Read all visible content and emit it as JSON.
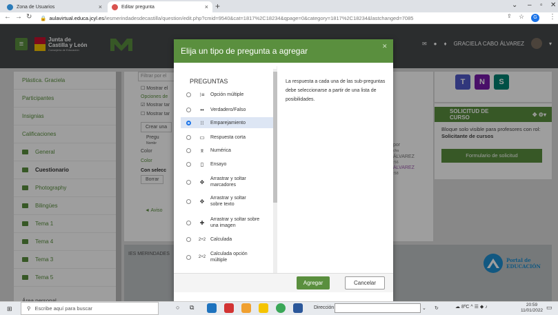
{
  "browser": {
    "tabs": [
      {
        "title": "Zona de Usuarios",
        "icon": "moodle-icon"
      },
      {
        "title": "Editar pregunta",
        "icon": "moodle-icon"
      }
    ],
    "url_domain": "aulavirtual.educa.jcyl.es",
    "url_path": "/iesmerindadesdecastilla/question/edit.php?cmid=9540&cat=1817%2C18234&qpage=0&category=1817%2C18234&lastchanged=7085"
  },
  "header": {
    "org_name_line1": "Junta de",
    "org_name_line2": "Castilla y León",
    "org_subtitle": "Consejería de Educación",
    "user_name": "GRACIELA CABO ÁLVAREZ"
  },
  "sidebar": {
    "items": [
      {
        "label": "Plástica. Graciela",
        "icon": ""
      },
      {
        "label": "Participantes",
        "icon": ""
      },
      {
        "label": "Insignias",
        "icon": ""
      },
      {
        "label": "Calificaciones",
        "icon": ""
      },
      {
        "label": "General",
        "icon": "folder-icon"
      },
      {
        "label": "Cuestionario",
        "icon": "folder-icon"
      },
      {
        "label": "Photography",
        "icon": "folder-icon"
      },
      {
        "label": "Bilingües",
        "icon": "folder-icon"
      },
      {
        "label": "Tema 1",
        "icon": "folder-icon"
      },
      {
        "label": "Tema 4",
        "icon": "folder-icon"
      },
      {
        "label": "Tema 3",
        "icon": "folder-icon"
      },
      {
        "label": "Tema 5",
        "icon": "folder-icon"
      },
      {
        "label": "Área personal",
        "icon": ""
      }
    ]
  },
  "background": {
    "filter_placeholder": "Filtrar por el",
    "show_a": "Mostrar el",
    "options": "Opciones de",
    "show_b": "Mostrar tar",
    "show_c": "Mostrar tar",
    "create": "Crear una",
    "col_preg": "Pregu",
    "col_nombre": "Nombr",
    "row_color1": "Color",
    "row_color2": "Color",
    "with_selected": "Con selecc",
    "delete": "Borrar",
    "notice": "◄ Aviso",
    "footer_school": "IES MERINDADES",
    "mid_por": "por",
    "mid_fecha": "cha",
    "mid_alvarez1": "ÁLVAREZ",
    "mid_56a": ":56",
    "mid_alvarez2": "ÁLVAREZ",
    "mid_56b": ":58"
  },
  "right_block": {
    "title_line1": "SOLICITUD DE",
    "title_line2": "CURSO",
    "text_part1": "Bloque solo visible para profesores con rol: ",
    "text_bold": "Solicitante de cursos",
    "button_label": "Formulario de solicitud",
    "portal_label1": "Portal de",
    "portal_label2": "EDUCACIÓN",
    "ms_teams": "T",
    "ms_onenote": "N",
    "ms_sway": "S"
  },
  "modal": {
    "title": "Elija un tipo de pregunta a agregar",
    "list_heading": "PREGUNTAS",
    "questions": [
      {
        "label": "Opción múltiple",
        "icon": "list-icon",
        "glyph": "⁝≡",
        "selected": false
      },
      {
        "label": "Verdadero/Falso",
        "icon": "dots-icon",
        "glyph": "••",
        "selected": false
      },
      {
        "label": "Emparejamiento",
        "icon": "matching-icon",
        "glyph": "⁝⁝",
        "selected": true
      },
      {
        "label": "Respuesta corta",
        "icon": "short-answer-icon",
        "glyph": "▭",
        "selected": false
      },
      {
        "label": "Numérica",
        "icon": "numeric-icon",
        "glyph": "⌆",
        "selected": false
      },
      {
        "label": "Ensayo",
        "icon": "essay-icon",
        "glyph": "▯",
        "selected": false
      },
      {
        "label": "Arrastrar y soltar marcadores",
        "icon": "move-icon",
        "glyph": "✥",
        "selected": false
      },
      {
        "label": "Arrastrar y soltar sobre texto",
        "icon": "move-icon",
        "glyph": "✥",
        "selected": false
      },
      {
        "label": "Arrastrar y soltar sobre una imagen",
        "icon": "cross-icon",
        "glyph": "✚",
        "selected": false
      },
      {
        "label": "Calculada",
        "icon": "calculated-icon",
        "glyph": "2+2",
        "selected": false
      },
      {
        "label": "Calculada opción múltiple",
        "icon": "calculated-icon",
        "glyph": "2+2",
        "selected": false
      }
    ],
    "description": "La respuesta a cada una de las sub-preguntas debe seleccionarse a partir de una lista de posibilidades.",
    "add_label": "Agregar",
    "cancel_label": "Cancelar",
    "close_glyph": "✕"
  },
  "taskbar": {
    "search_placeholder": "Escribe aquí para buscar",
    "address_label": "Dirección",
    "temperature": "8ºC",
    "time": "20:59",
    "date": "11/01/2022"
  },
  "colors": {
    "accent": "#5a8f3e",
    "selected_row": "#dde6f4",
    "radio_on": "#1a73e8"
  }
}
